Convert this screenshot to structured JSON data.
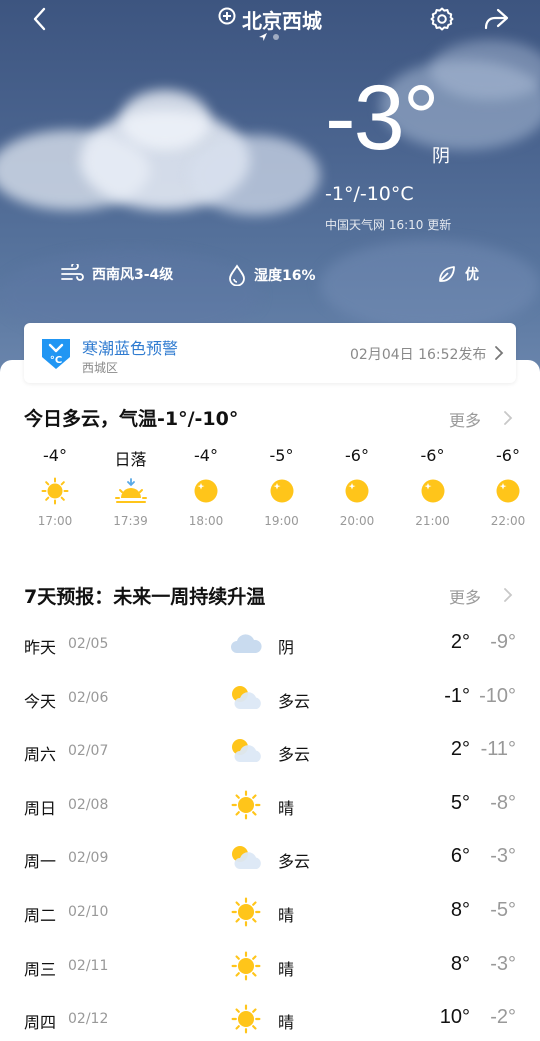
{
  "header": {
    "location": "北京西城",
    "icons": [
      "back-icon",
      "location-pin-icon",
      "settings-gear-icon",
      "share-icon"
    ]
  },
  "current": {
    "temp": "-3°",
    "condition": "阴",
    "range": "-1°/-10°C",
    "source": "中国天气网 16:10 更新",
    "wind": "西南风3-4级",
    "humidity": "湿度16%",
    "air_quality": "优"
  },
  "alert": {
    "title": "寒潮蓝色预警",
    "area": "西城区",
    "time": "02月04日 16:52发布",
    "icon_text": "°C"
  },
  "today": {
    "title": "今日多云，气温-1°/-10°",
    "more": "更多",
    "hours": [
      {
        "temp": "-4°",
        "time": "17:00",
        "icon": "sun"
      },
      {
        "temp": "日落",
        "time": "17:39",
        "icon": "sunset"
      },
      {
        "temp": "-4°",
        "time": "18:00",
        "icon": "moon"
      },
      {
        "temp": "-5°",
        "time": "19:00",
        "icon": "moon"
      },
      {
        "temp": "-6°",
        "time": "20:00",
        "icon": "moon"
      },
      {
        "temp": "-6°",
        "time": "21:00",
        "icon": "moon"
      },
      {
        "temp": "-6°",
        "time": "22:00",
        "icon": "moon"
      }
    ]
  },
  "forecast": {
    "title": "7天预报：未来一周持续升温",
    "more": "更多",
    "days": [
      {
        "name": "昨天",
        "date": "02/05",
        "icon": "cloud",
        "cond": "阴",
        "hi": "2°",
        "lo": "-9°"
      },
      {
        "name": "今天",
        "date": "02/06",
        "icon": "partly",
        "cond": "多云",
        "hi": "-1°",
        "lo": "-10°"
      },
      {
        "name": "周六",
        "date": "02/07",
        "icon": "partly",
        "cond": "多云",
        "hi": "2°",
        "lo": "-11°"
      },
      {
        "name": "周日",
        "date": "02/08",
        "icon": "sun",
        "cond": "晴",
        "hi": "5°",
        "lo": "-8°"
      },
      {
        "name": "周一",
        "date": "02/09",
        "icon": "partly",
        "cond": "多云",
        "hi": "6°",
        "lo": "-3°"
      },
      {
        "name": "周二",
        "date": "02/10",
        "icon": "sun",
        "cond": "晴",
        "hi": "8°",
        "lo": "-5°"
      },
      {
        "name": "周三",
        "date": "02/11",
        "icon": "sun",
        "cond": "晴",
        "hi": "8°",
        "lo": "-3°"
      },
      {
        "name": "周四",
        "date": "02/12",
        "icon": "sun",
        "cond": "晴",
        "hi": "10°",
        "lo": "-2°"
      }
    ]
  },
  "colors": {
    "sky": "#4b6590",
    "alert_blue": "#2f7bd0",
    "sun": "#ffc51a",
    "muted": "#999999"
  }
}
